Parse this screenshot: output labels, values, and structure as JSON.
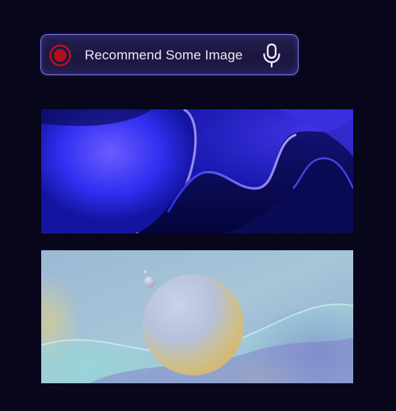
{
  "prompt": {
    "text": "Recommend Some Image",
    "record_icon": "record-icon",
    "mic_icon": "microphone-icon"
  },
  "images": [
    {
      "name": "blue-abstract-waves-image",
      "palette": [
        "#0a0a55",
        "#2a2aff",
        "#9a8cff"
      ]
    },
    {
      "name": "pastel-sphere-image",
      "palette": [
        "#9fbfd8",
        "#c9b87a",
        "#7b73c9"
      ]
    }
  ],
  "colors": {
    "background": "#07061a",
    "bar_border": "#7a7ae8",
    "record_red": "#c0121f"
  }
}
